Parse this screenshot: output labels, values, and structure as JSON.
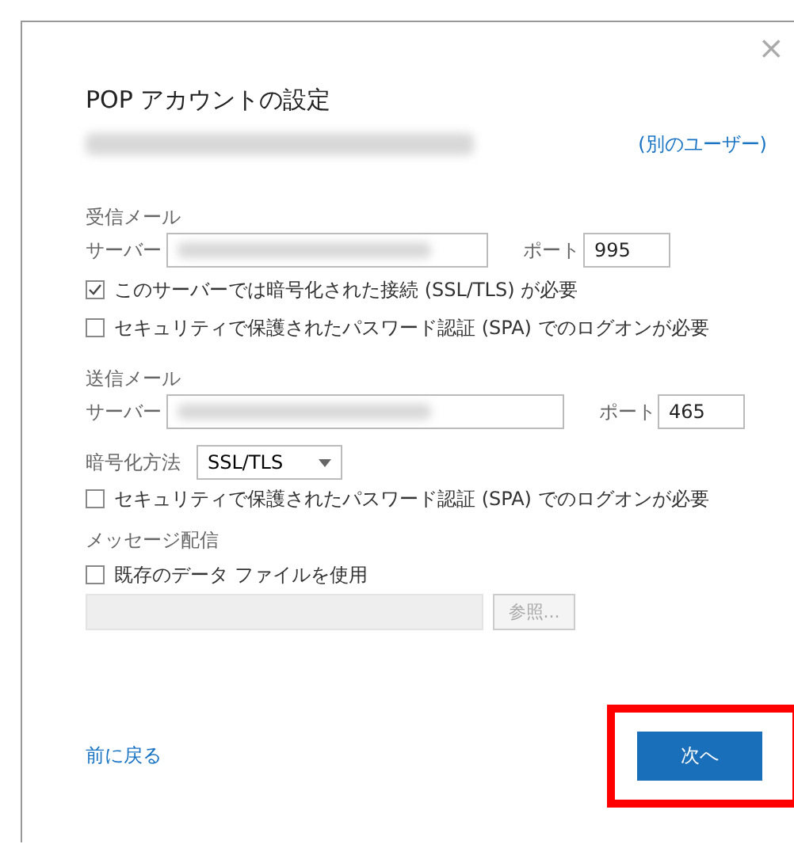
{
  "dialog": {
    "title": "POP アカウントの設定",
    "close": "×",
    "other_user_link": "(別のユーザー)"
  },
  "incoming": {
    "heading": "受信メール",
    "server_label": "サーバー",
    "port_label": "ポート",
    "port": "995",
    "options": [
      {
        "label": "このサーバーでは暗号化された接続 (SSL/TLS) が必要",
        "checked": true
      },
      {
        "label": "セキュリティで保護されたパスワード認証 (SPA) でのログオンが必要",
        "checked": false
      }
    ]
  },
  "outgoing": {
    "heading": "送信メール",
    "server_label": "サーバー",
    "port_label": "ポート",
    "port": "465",
    "encryption_label": "暗号化方法",
    "encryption": "SSL/TLS",
    "options": [
      {
        "label": "セキュリティで保護されたパスワード認証 (SPA) でのログオンが必要",
        "checked": false
      }
    ]
  },
  "delivery": {
    "heading": "メッセージ配信",
    "option": {
      "label": "既存のデータ ファイルを使用",
      "checked": false
    },
    "browse_button": {
      "label": "参照...",
      "disabled": true
    }
  },
  "footer": {
    "back_link": "前に戻る",
    "next_button": {
      "label": "次へ",
      "highlighted": true
    }
  }
}
